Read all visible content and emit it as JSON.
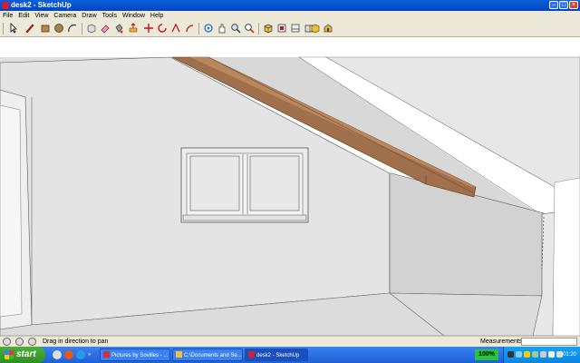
{
  "window": {
    "title": "desk2 - SketchUp"
  },
  "menu": [
    "File",
    "Edit",
    "View",
    "Camera",
    "Draw",
    "Tools",
    "Window",
    "Help"
  ],
  "toolbar": {
    "tools": [
      "select-icon",
      "pencil-icon",
      "rectangle-icon",
      "circle-icon",
      "arc-icon",
      "make-component-icon",
      "eraser-icon",
      "paint-bucket-icon",
      "push-pull-icon",
      "move-icon",
      "rotate-icon",
      "follow-me-icon",
      "orbit-icon",
      "pan-icon",
      "zoom-icon",
      "zoom-extents-icon",
      "iso-view-icon",
      "top-view-icon",
      "front-view-icon",
      "right-view-icon",
      "box-icon",
      "warehouse-icon"
    ]
  },
  "status": {
    "message": "Drag in direction to pan",
    "measurements_label": "Measurements"
  },
  "taskbar": {
    "start_label": "start",
    "tasks": [
      "Pictures by Sovilles - ...",
      "C:\\Documents and Se...",
      "desk2 - SketchUp"
    ],
    "zoom": "100%",
    "clock": "01:20"
  },
  "colors": {
    "rafter": "#a0704c",
    "wall": "#e4e4e4",
    "shadow_wall": "#d2d2d2",
    "sky": "#ffffff"
  }
}
